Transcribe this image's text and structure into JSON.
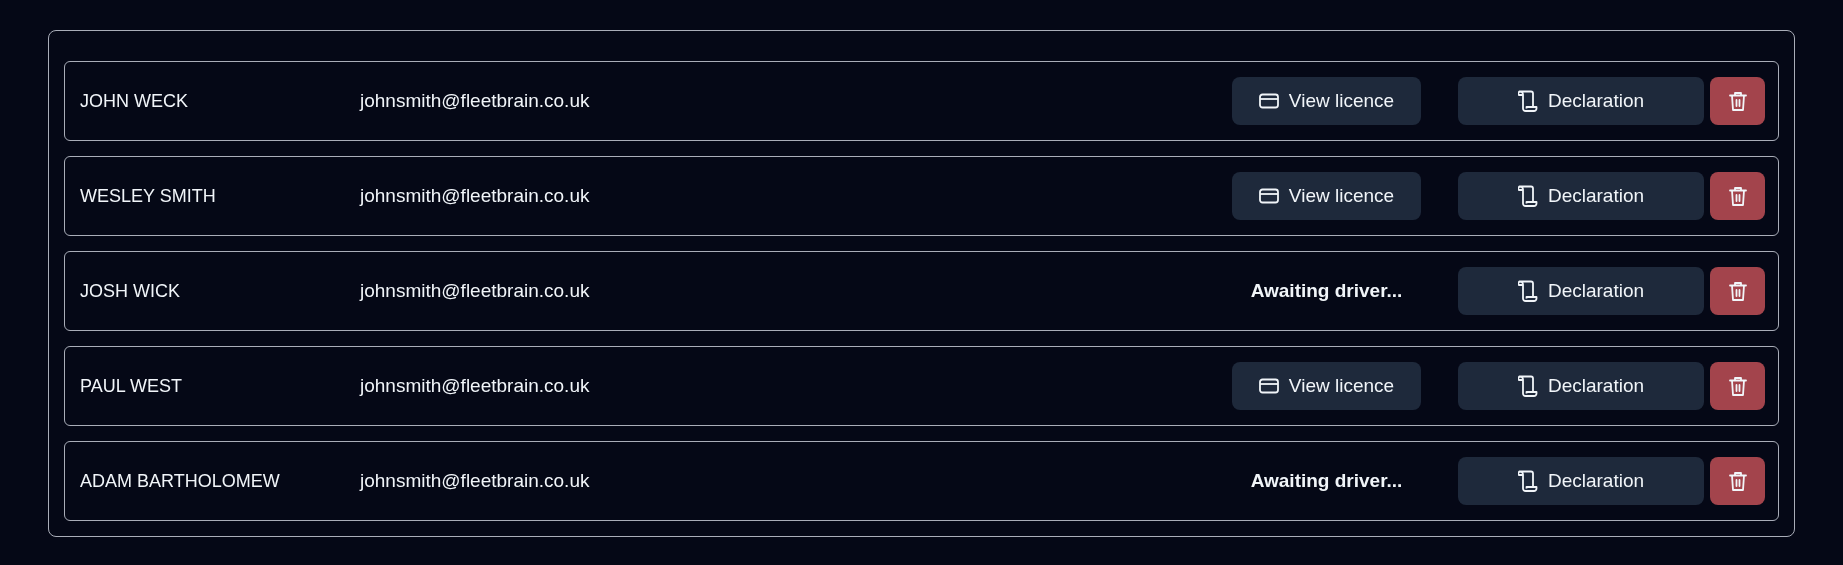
{
  "drivers": [
    {
      "name": "JOHN WECK",
      "email": "johnsmith@fleetbrain.co.uk",
      "licence": {
        "kind": "button",
        "label": "View licence"
      },
      "declaration": "Declaration"
    },
    {
      "name": "WESLEY SMITH",
      "email": "johnsmith@fleetbrain.co.uk",
      "licence": {
        "kind": "button",
        "label": "View licence"
      },
      "declaration": "Declaration"
    },
    {
      "name": "JOSH WICK",
      "email": "johnsmith@fleetbrain.co.uk",
      "licence": {
        "kind": "status",
        "label": "Awaiting driver..."
      },
      "declaration": "Declaration"
    },
    {
      "name": "PAUL WEST",
      "email": "johnsmith@fleetbrain.co.uk",
      "licence": {
        "kind": "button",
        "label": "View licence"
      },
      "declaration": "Declaration"
    },
    {
      "name": "ADAM BARTHOLOMEW",
      "email": "johnsmith@fleetbrain.co.uk",
      "licence": {
        "kind": "status",
        "label": "Awaiting driver..."
      },
      "declaration": "Declaration"
    }
  ]
}
